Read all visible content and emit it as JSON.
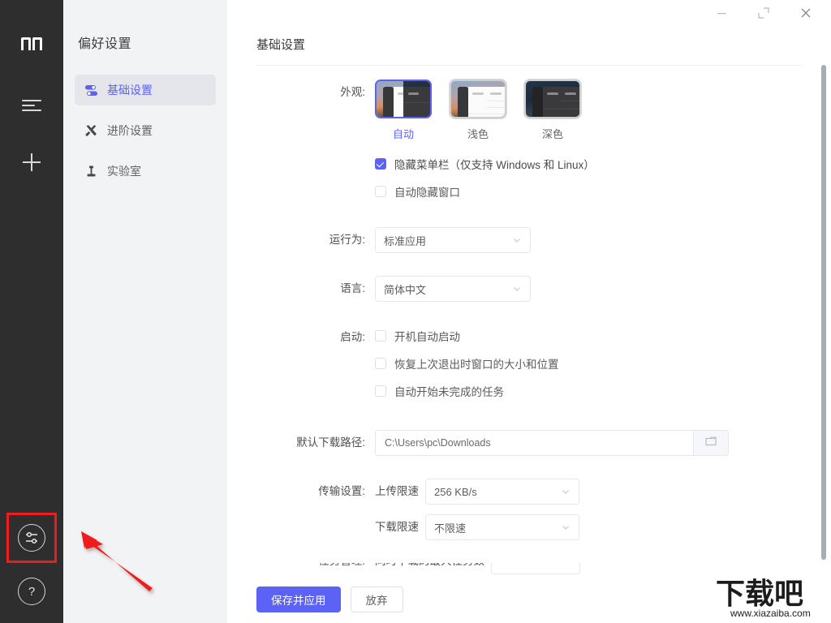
{
  "window": {
    "controls": [
      {
        "name": "minimize",
        "glyph": "minimize-icon"
      },
      {
        "name": "maximize",
        "glyph": "maximize-icon"
      },
      {
        "name": "close",
        "glyph": "close-icon"
      }
    ]
  },
  "rail": {
    "logo": "m",
    "items": [
      {
        "name": "task-list-icon",
        "label": ""
      },
      {
        "name": "add-task-icon",
        "label": ""
      }
    ],
    "settings_icon": "sliders-icon",
    "help_icon": "question-mark-icon",
    "highlight_color": "#ee1c1c"
  },
  "prefs": {
    "title": "偏好设置",
    "items": [
      {
        "label": "基础设置",
        "icon": "toggle-switches-icon",
        "active": true
      },
      {
        "label": "进阶设置",
        "icon": "tools-icon",
        "active": false
      },
      {
        "label": "实验室",
        "icon": "flask-icon",
        "active": false
      }
    ]
  },
  "page": {
    "title": "基础设置",
    "accent": "#5b62f4"
  },
  "form": {
    "appearance": {
      "label": "外观:",
      "options": [
        {
          "name": "自动",
          "selected": true,
          "mode": "auto"
        },
        {
          "name": "浅色",
          "selected": false,
          "mode": "light"
        },
        {
          "name": "深色",
          "selected": false,
          "mode": "dark"
        }
      ],
      "checkboxes": [
        {
          "label": "隐藏菜单栏（仅支持 Windows 和 Linux）",
          "checked": true
        },
        {
          "label": "自动隐藏窗口",
          "checked": false
        }
      ]
    },
    "run_mode": {
      "label": "运行为:",
      "value": "标准应用"
    },
    "language": {
      "label": "语言:",
      "value": "简体中文"
    },
    "startup": {
      "label": "启动:",
      "checkboxes": [
        {
          "label": "开机自动启动",
          "checked": false
        },
        {
          "label": "恢复上次退出时窗口的大小和位置",
          "checked": false
        },
        {
          "label": "自动开始未完成的任务",
          "checked": false
        }
      ]
    },
    "download_path": {
      "label": "默认下载路径:",
      "value": "C:\\Users\\pc\\Downloads",
      "browse_icon": "folder-icon"
    },
    "transfer": {
      "label": "传输设置:",
      "upload": {
        "label": "上传限速",
        "value": "256 KB/s"
      },
      "download": {
        "label": "下载限速",
        "value": "不限速"
      }
    },
    "task_manage": {
      "label": "任务管理:",
      "sub_label": "同时下载的最大任务数",
      "value": ""
    }
  },
  "footer": {
    "save_label": "保存并应用",
    "discard_label": "放弃"
  },
  "watermark": {
    "text": "下载吧",
    "url": "www.xiazaiba.com"
  }
}
